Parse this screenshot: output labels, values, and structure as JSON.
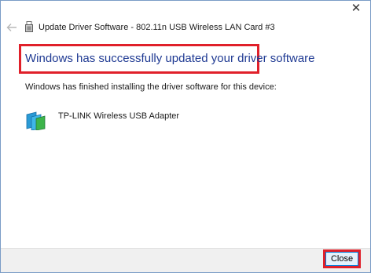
{
  "window": {
    "title": "Update Driver Software - 802.11n USB Wireless LAN Card #3",
    "close_glyph": "✕"
  },
  "main": {
    "headline": "Windows has successfully updated your driver software",
    "subtext": "Windows has finished installing the driver software for this device:",
    "device_name": "TP-LINK Wireless USB Adapter",
    "device_icon": "network-adapter-icon"
  },
  "footer": {
    "close_label": "Close"
  },
  "colors": {
    "headline": "#1f3a93",
    "highlight_outline": "#e0202a",
    "button_border": "#0078d7"
  }
}
